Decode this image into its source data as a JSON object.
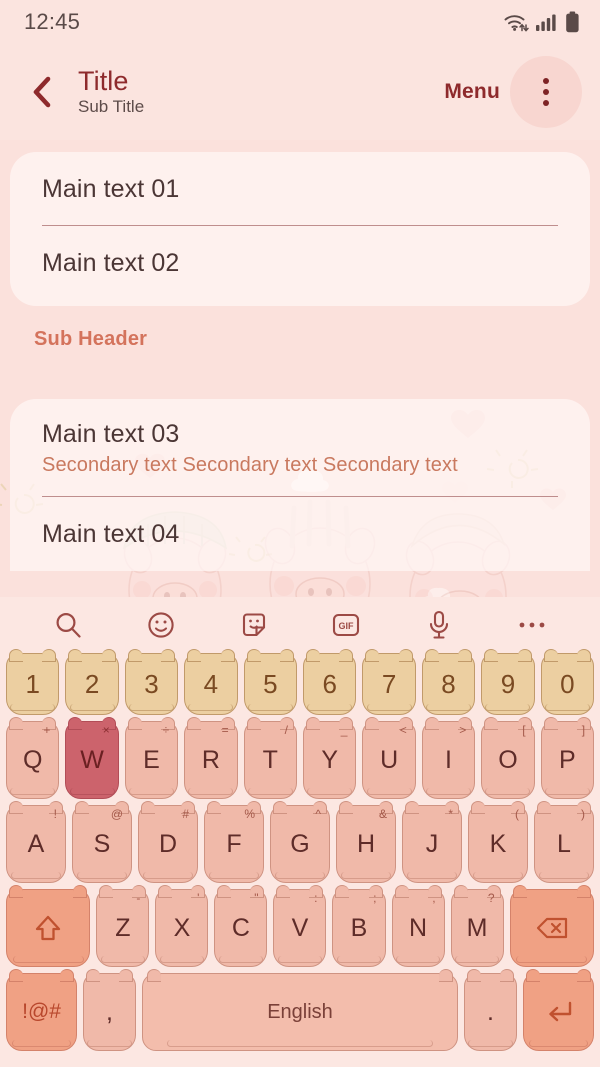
{
  "theme": {
    "bg": "#fbe4df",
    "card_bg": "#fff6f5",
    "title_color": "#8e2a2c",
    "accent_color": "#d4735c",
    "key_bg": "#f0b9a9",
    "key_num_bg": "#eccfa1",
    "key_accent_bg": "#f0a184",
    "key_pressed_bg": "#cc636c"
  },
  "statusbar": {
    "time": "12:45",
    "icons": [
      "wifi-icon",
      "signal-icon",
      "battery-icon"
    ]
  },
  "appbar": {
    "back_icon": "chevron-left-icon",
    "title": "Title",
    "subtitle": "Sub Title",
    "menu_label": "Menu",
    "overflow_icon": "more-vertical-icon"
  },
  "content": {
    "card1": [
      {
        "main": "Main text 01",
        "secondary": ""
      },
      {
        "main": "Main text 02",
        "secondary": ""
      }
    ],
    "sub_header": "Sub Header",
    "card2": [
      {
        "main": "Main text 03",
        "secondary": "Secondary text Secondary text Secondary text"
      },
      {
        "main": "Main text 04",
        "secondary": ""
      }
    ]
  },
  "keyboard": {
    "toolbar": [
      {
        "name": "search-icon",
        "label": ""
      },
      {
        "name": "emoji-icon",
        "label": ""
      },
      {
        "name": "sticker-icon",
        "label": ""
      },
      {
        "name": "gif-icon",
        "label": "GIF"
      },
      {
        "name": "microphone-icon",
        "label": ""
      },
      {
        "name": "more-horizontal-icon",
        "label": ""
      }
    ],
    "rows": {
      "numbers": [
        {
          "key": "1"
        },
        {
          "key": "2"
        },
        {
          "key": "3"
        },
        {
          "key": "4"
        },
        {
          "key": "5"
        },
        {
          "key": "6"
        },
        {
          "key": "7"
        },
        {
          "key": "8"
        },
        {
          "key": "9"
        },
        {
          "key": "0"
        }
      ],
      "top": [
        {
          "key": "Q",
          "sup": "+"
        },
        {
          "key": "W",
          "sup": "×",
          "pressed": true
        },
        {
          "key": "E",
          "sup": "÷"
        },
        {
          "key": "R",
          "sup": "="
        },
        {
          "key": "T",
          "sup": "/"
        },
        {
          "key": "Y",
          "sup": "_"
        },
        {
          "key": "U",
          "sup": "<"
        },
        {
          "key": "I",
          "sup": ">"
        },
        {
          "key": "O",
          "sup": "["
        },
        {
          "key": "P",
          "sup": "]"
        }
      ],
      "home": [
        {
          "key": "A",
          "sup": "!"
        },
        {
          "key": "S",
          "sup": "@"
        },
        {
          "key": "D",
          "sup": "#"
        },
        {
          "key": "F",
          "sup": "%"
        },
        {
          "key": "G",
          "sup": "^"
        },
        {
          "key": "H",
          "sup": "&"
        },
        {
          "key": "J",
          "sup": "*"
        },
        {
          "key": "K",
          "sup": "("
        },
        {
          "key": "L",
          "sup": ")"
        }
      ],
      "bottom_letters": [
        {
          "key": "Z",
          "sup": "-"
        },
        {
          "key": "X",
          "sup": "'"
        },
        {
          "key": "C",
          "sup": "\""
        },
        {
          "key": "V",
          "sup": ":"
        },
        {
          "key": "B",
          "sup": ";"
        },
        {
          "key": "N",
          "sup": ","
        },
        {
          "key": "M",
          "sup": "?"
        }
      ],
      "shift_icon": "shift-up-arrow-icon",
      "backspace_icon": "backspace-icon",
      "symbols_label": "!@#",
      "comma_label": ",",
      "space_label": "English",
      "period_label": ".",
      "enter_icon": "enter-return-icon"
    }
  }
}
